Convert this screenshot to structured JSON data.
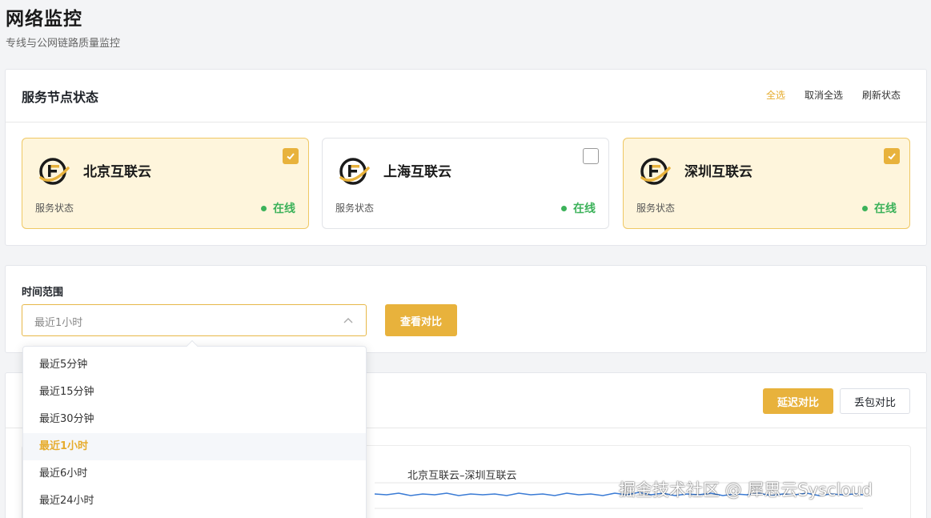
{
  "page": {
    "title": "网络监控",
    "subtitle": "专线与公网链路质量监控"
  },
  "nodes_panel": {
    "title": "服务节点状态",
    "actions": {
      "select_all": "全选",
      "deselect_all": "取消全选",
      "refresh": "刷新状态"
    },
    "nodes": [
      {
        "name": "北京互联云",
        "status_label": "服务状态",
        "status": "在线",
        "selected": true
      },
      {
        "name": "上海互联云",
        "status_label": "服务状态",
        "status": "在线",
        "selected": false
      },
      {
        "name": "深圳互联云",
        "status_label": "服务状态",
        "status": "在线",
        "selected": true
      }
    ]
  },
  "time_panel": {
    "label": "时间范围",
    "selected_value": "最近1小时",
    "compare_button": "查看对比",
    "options": [
      "最近5分钟",
      "最近15分钟",
      "最近30分钟",
      "最近1小时",
      "最近6小时",
      "最近24小时"
    ],
    "active_option_index": 3
  },
  "chart_panel": {
    "tabs": {
      "latency": "延迟对比",
      "packet_loss": "丢包对比"
    },
    "chart_title": "北京互联云–深圳互联云"
  },
  "watermark": "掘金技术社区 @ 犀思云Syscloud",
  "colors": {
    "accent": "#e8b23c",
    "online": "#3cb25a",
    "selected_bg": "#fef5dc",
    "series_line": "#3a7bd5"
  },
  "icons": {
    "node_logo": "syscloud-logo-icon",
    "checkbox": "check-icon",
    "select_arrow": "chevron-up-icon"
  }
}
